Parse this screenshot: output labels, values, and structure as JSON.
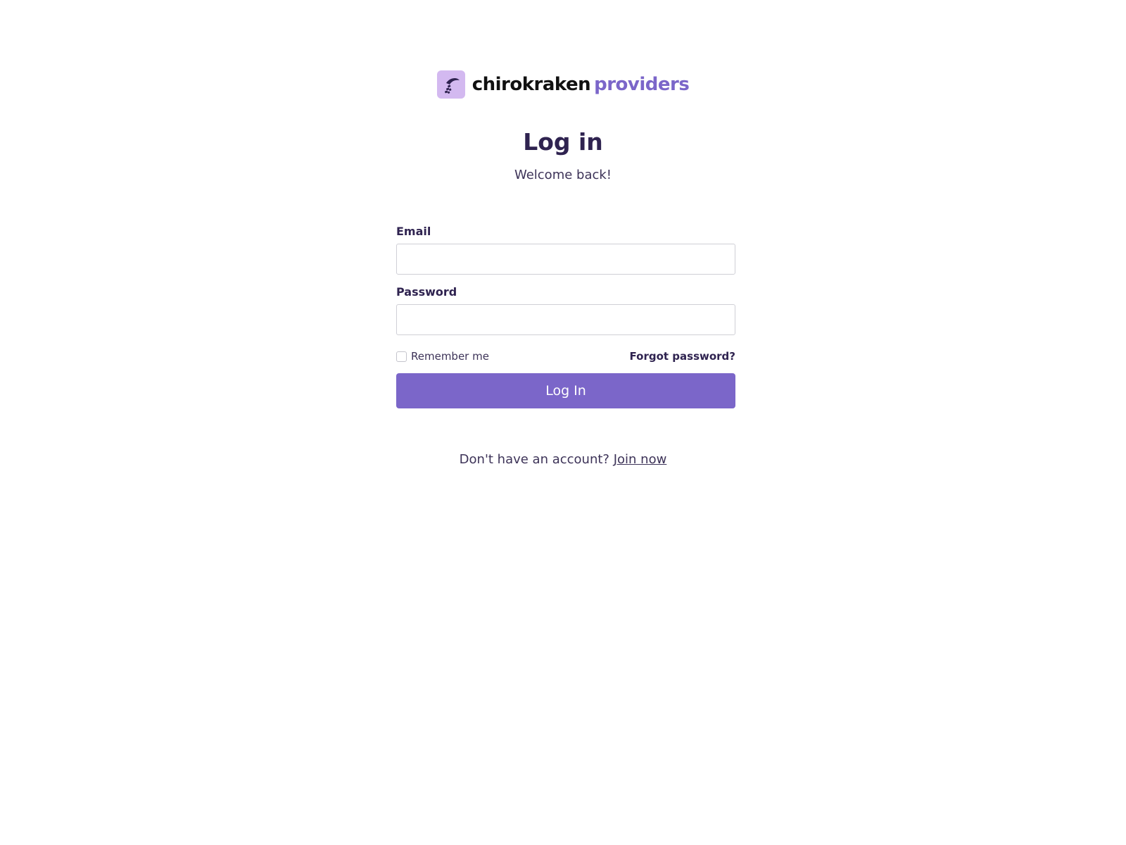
{
  "brand": {
    "name": "chirokraken",
    "suffix": "providers",
    "logo_icon": "brand-mark-icon"
  },
  "heading": {
    "title": "Log in",
    "subtitle": "Welcome back!"
  },
  "form": {
    "email_label": "Email",
    "email_value": "",
    "password_label": "Password",
    "password_value": "",
    "remember_label": "Remember me",
    "remember_checked": false,
    "forgot_link": "Forgot password?",
    "submit_label": "Log In"
  },
  "signup": {
    "prompt": "Don't have an account?",
    "link": "Join now"
  },
  "colors": {
    "accent": "#7b66c9",
    "logo_bg": "#d3b9f0",
    "text": "#2f2350"
  }
}
